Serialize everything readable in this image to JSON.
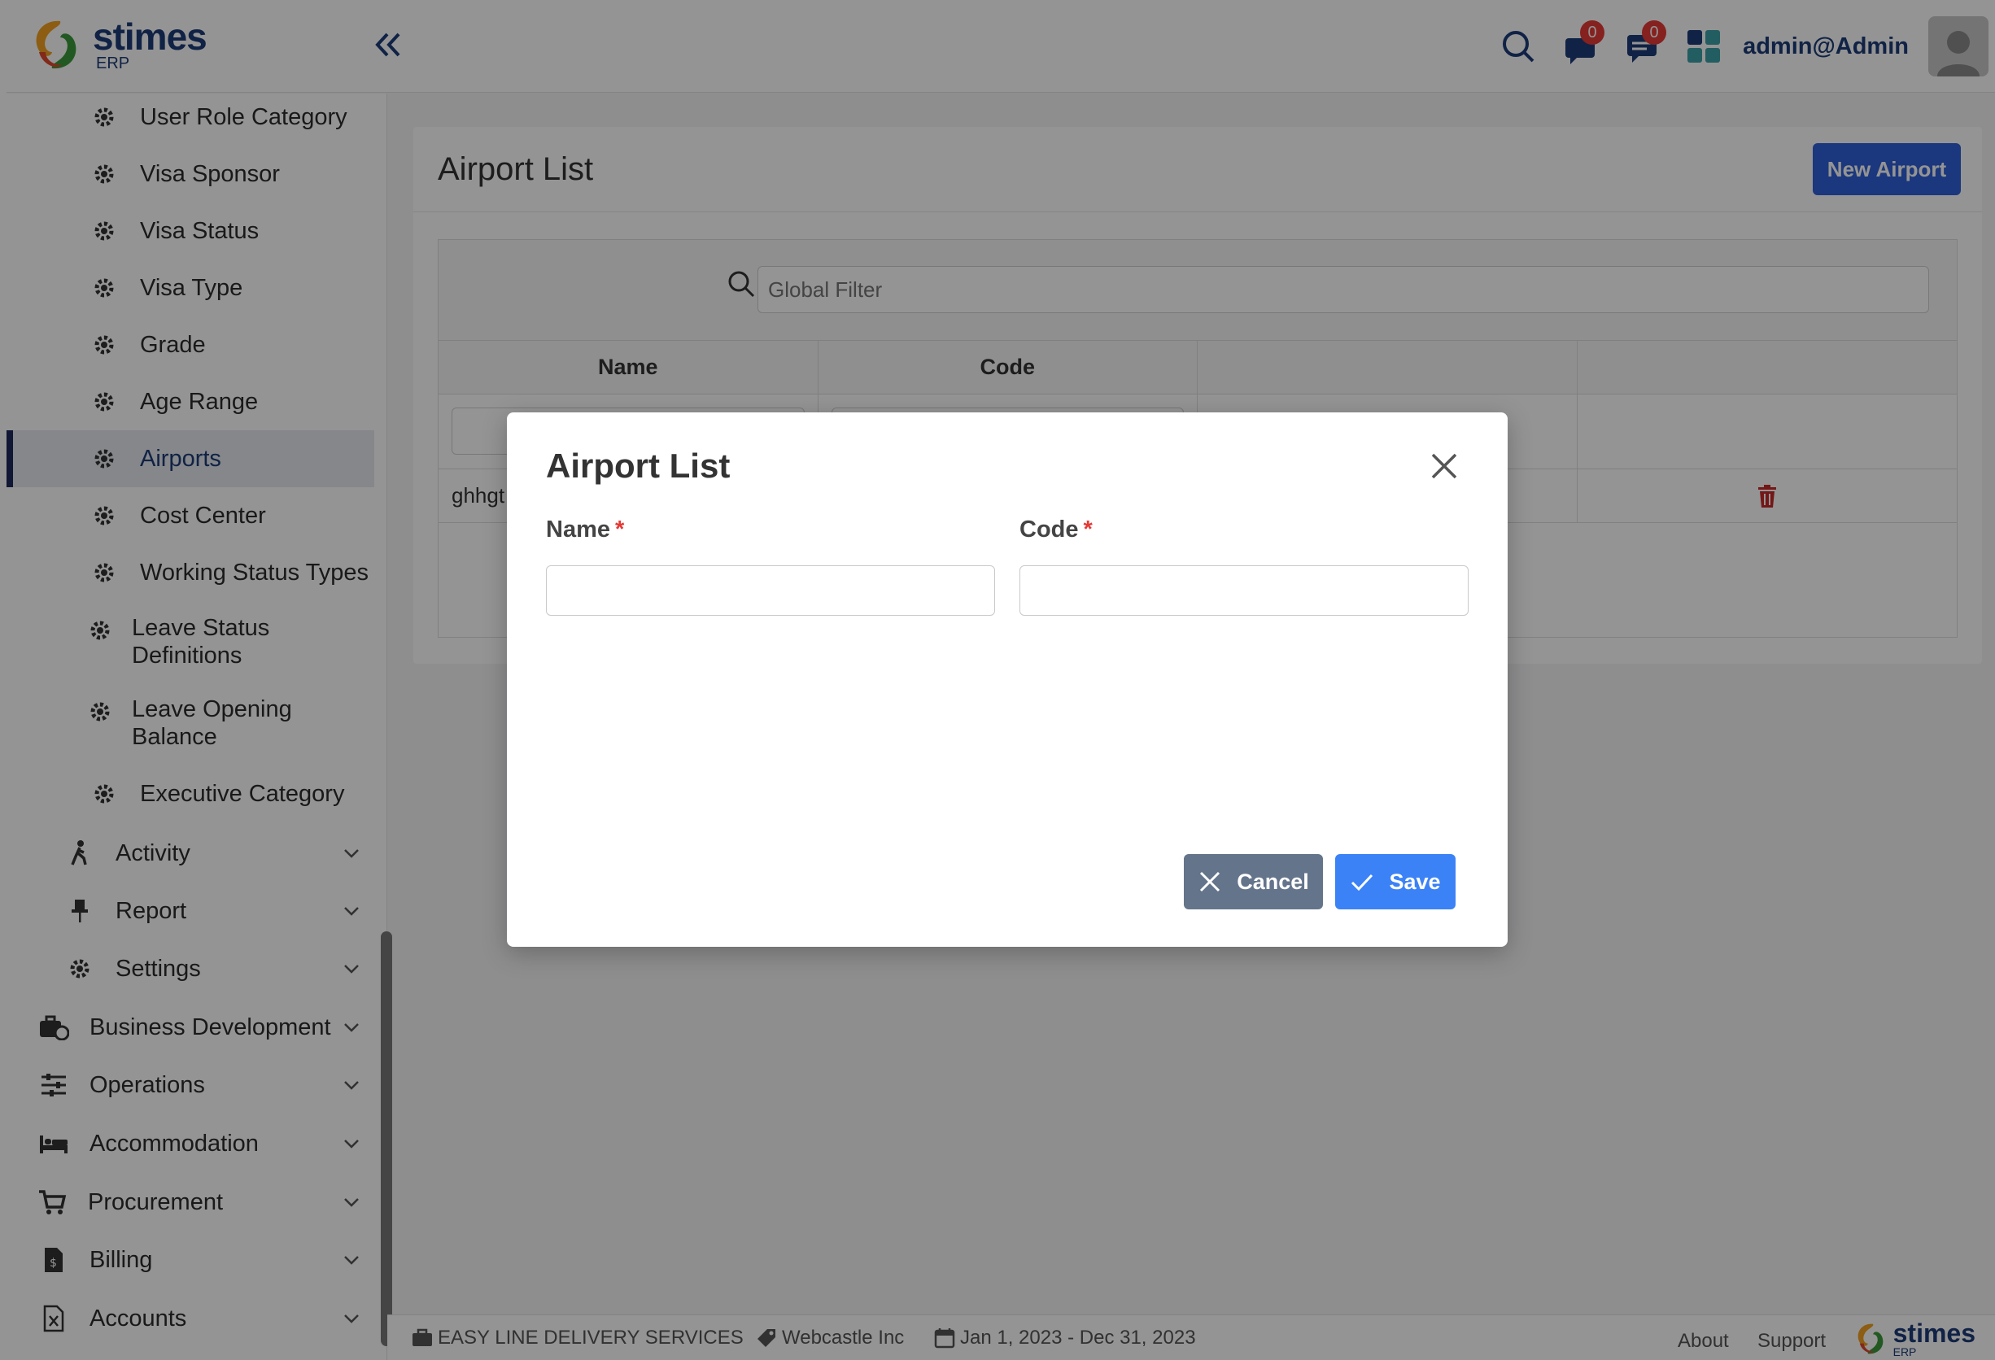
{
  "app": {
    "brand": "stimes",
    "brand_sub": "ERP",
    "user": "admin@Admin",
    "notifications_count": "0",
    "messages_count": "0"
  },
  "sidebar": {
    "sub_items": [
      {
        "label": "User Role Category"
      },
      {
        "label": "Visa Sponsor"
      },
      {
        "label": "Visa Status"
      },
      {
        "label": "Visa Type"
      },
      {
        "label": "Grade"
      },
      {
        "label": "Age Range"
      },
      {
        "label": "Airports",
        "active": true
      },
      {
        "label": "Cost Center"
      },
      {
        "label": "Working Status Types"
      },
      {
        "label": "Leave Status Definitions"
      },
      {
        "label": "Leave Opening Balance"
      },
      {
        "label": "Executive Category"
      }
    ],
    "groups": [
      {
        "label": "Activity",
        "icon": "walking-icon"
      },
      {
        "label": "Report",
        "icon": "pin-icon"
      },
      {
        "label": "Settings",
        "icon": "gear-icon"
      }
    ],
    "modules": [
      {
        "label": "Business Development",
        "icon": "briefcase-clock-icon"
      },
      {
        "label": "Operations",
        "icon": "sliders-icon"
      },
      {
        "label": "Accommodation",
        "icon": "bed-icon"
      },
      {
        "label": "Procurement",
        "icon": "cart-icon"
      },
      {
        "label": "Billing",
        "icon": "invoice-icon"
      },
      {
        "label": "Accounts",
        "icon": "excel-file-icon"
      }
    ]
  },
  "page": {
    "title": "Airport List",
    "new_button": "New Airport",
    "filter_placeholder": "Global Filter",
    "columns": [
      "Name",
      "Code",
      "",
      ""
    ],
    "rows": [
      {
        "name": "ghhgt",
        "code": ""
      }
    ]
  },
  "footer": {
    "company": "EASY LINE DELIVERY SERVICES",
    "vendor": "Webcastle Inc",
    "period": "Jan 1, 2023 - Dec 31, 2023",
    "about": "About",
    "support": "Support"
  },
  "modal": {
    "title": "Airport List",
    "name_label": "Name",
    "code_label": "Code",
    "required_mark": "*",
    "name_value": "",
    "code_value": "",
    "cancel": "Cancel",
    "save": "Save"
  },
  "colors": {
    "primary": "#2f5fd8",
    "brand": "#1d3c78",
    "danger": "#e53935",
    "cancel": "#64748b",
    "save": "#3b82f6"
  }
}
